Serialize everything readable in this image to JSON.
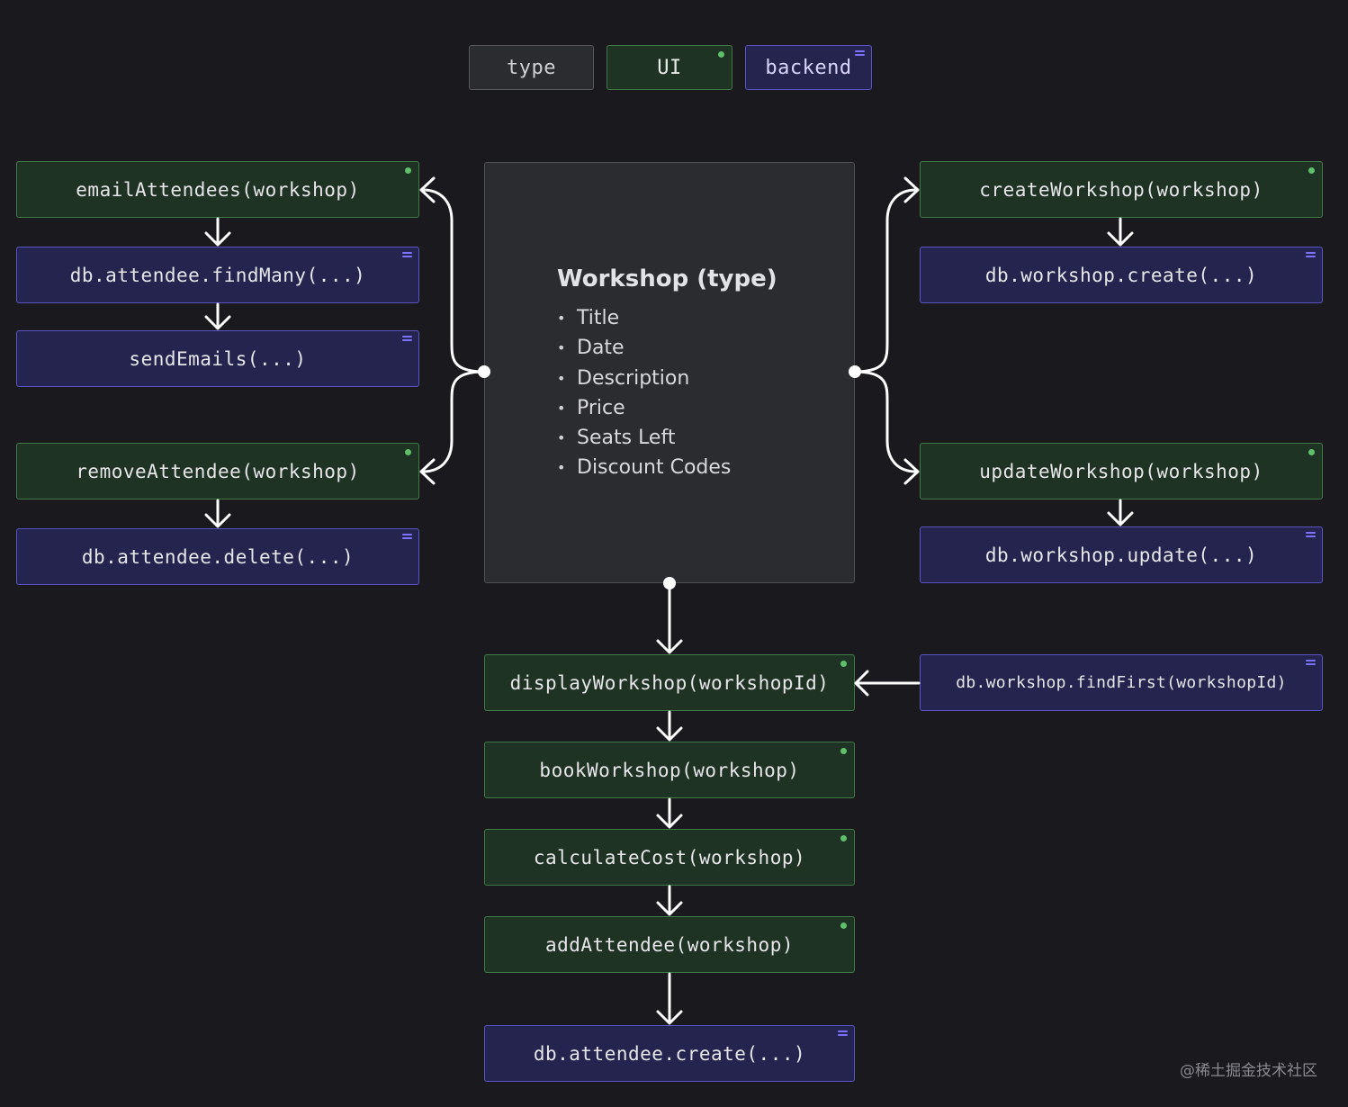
{
  "legend": {
    "type": "type",
    "ui": "UI",
    "backend": "backend"
  },
  "type_box": {
    "title": "Workshop (type)",
    "fields": [
      "Title",
      "Date",
      "Description",
      "Price",
      "Seats Left",
      "Discount Codes"
    ]
  },
  "nodes": {
    "email_attendees": "emailAttendees(workshop)",
    "attendee_find_many": "db.attendee.findMany(...)",
    "send_emails": "sendEmails(...)",
    "remove_attendee": "removeAttendee(workshop)",
    "attendee_delete": "db.attendee.delete(...)",
    "create_workshop": "createWorkshop(workshop)",
    "workshop_create": "db.workshop.create(...)",
    "update_workshop": "updateWorkshop(workshop)",
    "workshop_update": "db.workshop.update(...)",
    "display_workshop": "displayWorkshop(workshopId)",
    "workshop_find_first": "db.workshop.findFirst(workshopId)",
    "book_workshop": "bookWorkshop(workshop)",
    "calculate_cost": "calculateCost(workshop)",
    "add_attendee": "addAttendee(workshop)",
    "attendee_create": "db.attendee.create(...)"
  },
  "watermark": "@稀土掘金技术社区",
  "colors": {
    "background": "#19191e",
    "ui_fill": "#1e3324",
    "ui_border": "#3f7a48",
    "ui_dot": "#5fbf6a",
    "backend_fill": "#24244e",
    "backend_border": "#5a53c4",
    "backend_icon": "#7b72ff",
    "type_fill": "#2b2c30",
    "type_border": "#57585d",
    "connector": "#ffffff"
  }
}
